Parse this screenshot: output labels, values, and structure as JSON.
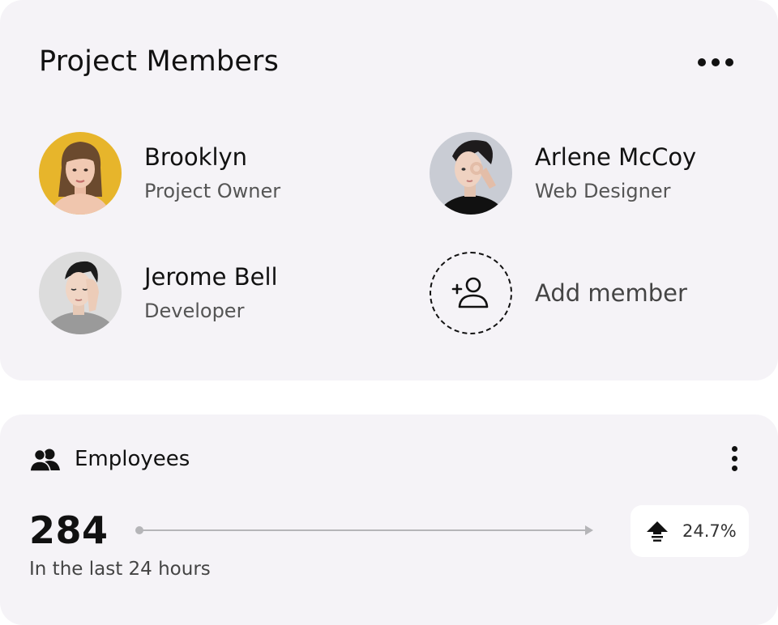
{
  "members_card": {
    "title": "Project Members",
    "members": [
      {
        "name": "Brooklyn",
        "role": "Project Owner"
      },
      {
        "name": "Arlene McCoy",
        "role": "Web Designer"
      },
      {
        "name": "Jerome Bell",
        "role": "Developer"
      }
    ],
    "add_member_label": "Add member",
    "icons": {
      "more": "more-horizontal-icon",
      "add": "add-user-icon"
    }
  },
  "employees_card": {
    "title": "Employees",
    "count": "284",
    "subtitle": "In the last 24 hours",
    "change": "24.7%",
    "icons": {
      "group": "users-icon",
      "more": "more-vertical-icon",
      "trend": "arrow-up-icon"
    }
  },
  "colors": {
    "card_bg": "#f5f3f7",
    "text": "#111111",
    "muted": "#555555"
  }
}
